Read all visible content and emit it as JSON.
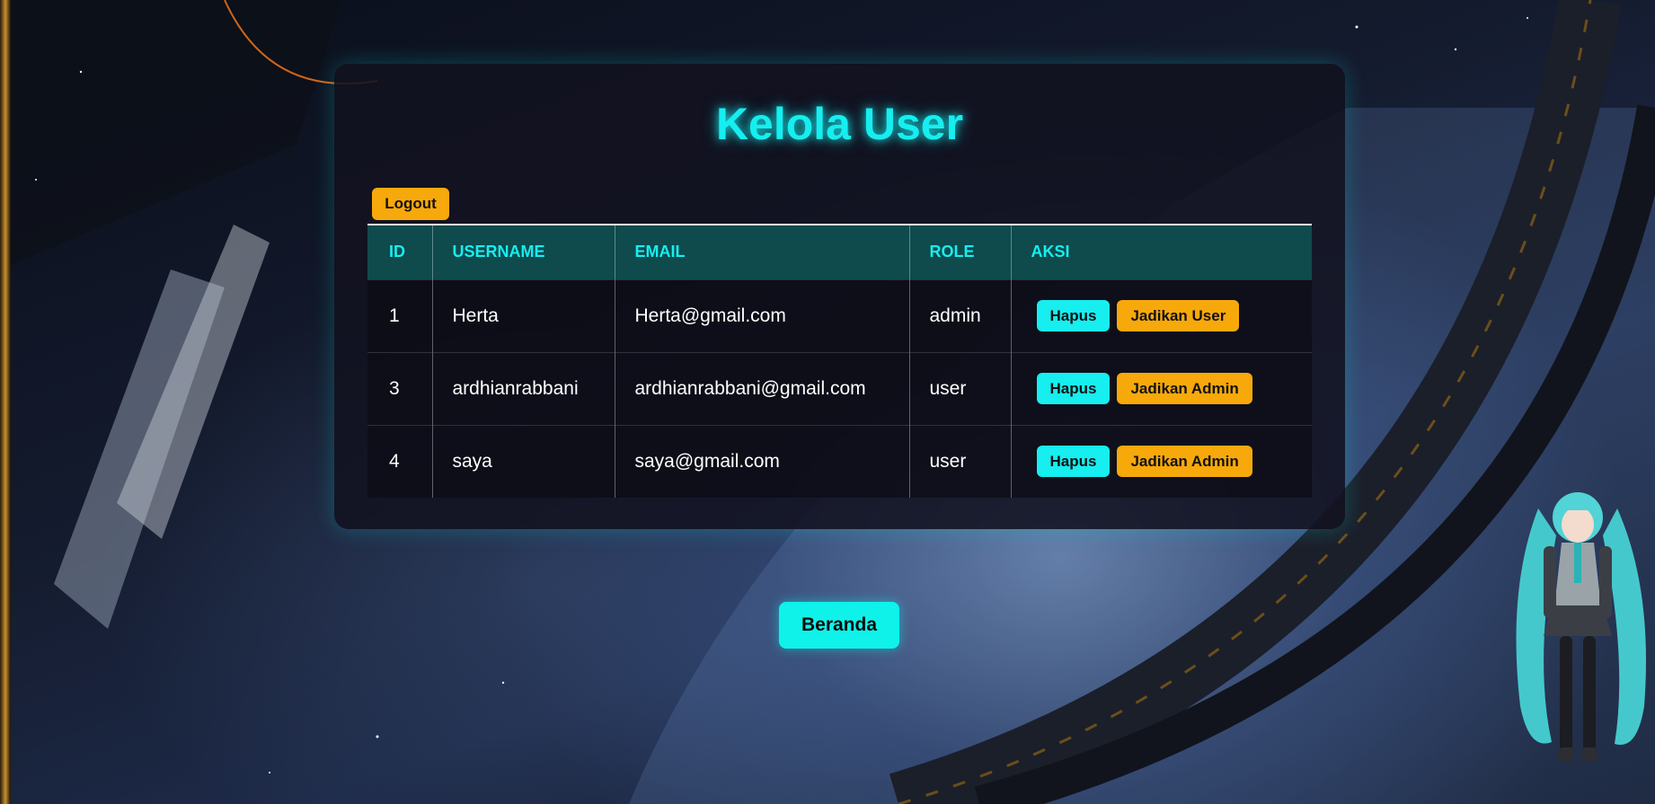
{
  "page": {
    "title": "Kelola User"
  },
  "actions": {
    "logout_label": "Logout",
    "home_label": "Beranda"
  },
  "table": {
    "headers": [
      "ID",
      "USERNAME",
      "EMAIL",
      "ROLE",
      "AKSI"
    ],
    "rows": [
      {
        "id": "1",
        "username": "Herta",
        "email": "Herta@gmail.com",
        "role": "admin",
        "delete_label": "Hapus",
        "role_action_label": "Jadikan User"
      },
      {
        "id": "3",
        "username": "ardhianrabbani",
        "email": "ardhianrabbani@gmail.com",
        "role": "user",
        "delete_label": "Hapus",
        "role_action_label": "Jadikan Admin"
      },
      {
        "id": "4",
        "username": "saya",
        "email": "saya@gmail.com",
        "role": "user",
        "delete_label": "Hapus",
        "role_action_label": "Jadikan Admin"
      }
    ]
  },
  "colors": {
    "accent_cyan": "#16eef0",
    "accent_orange": "#f7a90b",
    "header_bg": "#0f4a4c",
    "panel_bg": "#121220"
  }
}
